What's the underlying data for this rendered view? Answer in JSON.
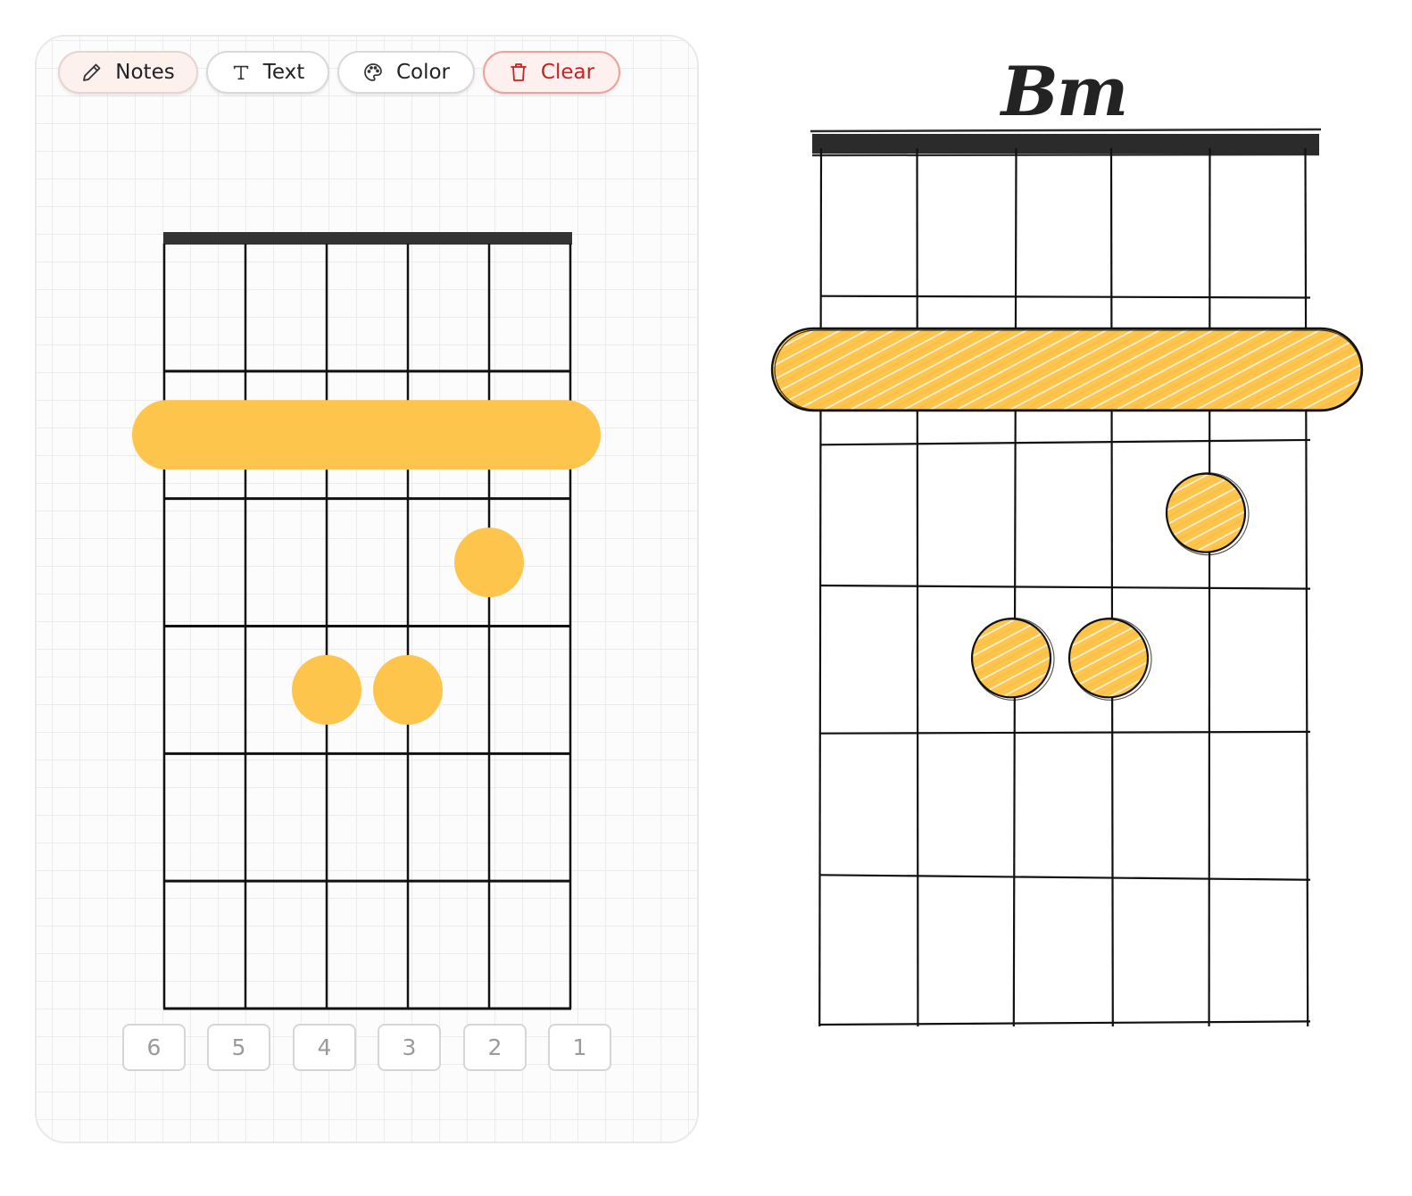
{
  "toolbar": {
    "notes_label": "Notes",
    "text_label": "Text",
    "color_label": "Color",
    "clear_label": "Clear",
    "icons": [
      "pencil-icon",
      "text-icon",
      "palette-icon",
      "trash-icon"
    ]
  },
  "colors": {
    "marker": "#FDC54C",
    "grid_line": "#111111",
    "nut": "#333333",
    "clear_accent": "#C62222"
  },
  "diagram": {
    "strings": 6,
    "frets": 6,
    "barre": {
      "fret": 2,
      "from_string": 6,
      "to_string": 1
    },
    "dots": [
      {
        "string": 2,
        "fret": 3
      },
      {
        "string": 4,
        "fret": 4
      },
      {
        "string": 3,
        "fret": 4
      }
    ],
    "string_labels": [
      "6",
      "5",
      "4",
      "3",
      "2",
      "1"
    ]
  },
  "preview": {
    "chord_name": "Bm"
  }
}
